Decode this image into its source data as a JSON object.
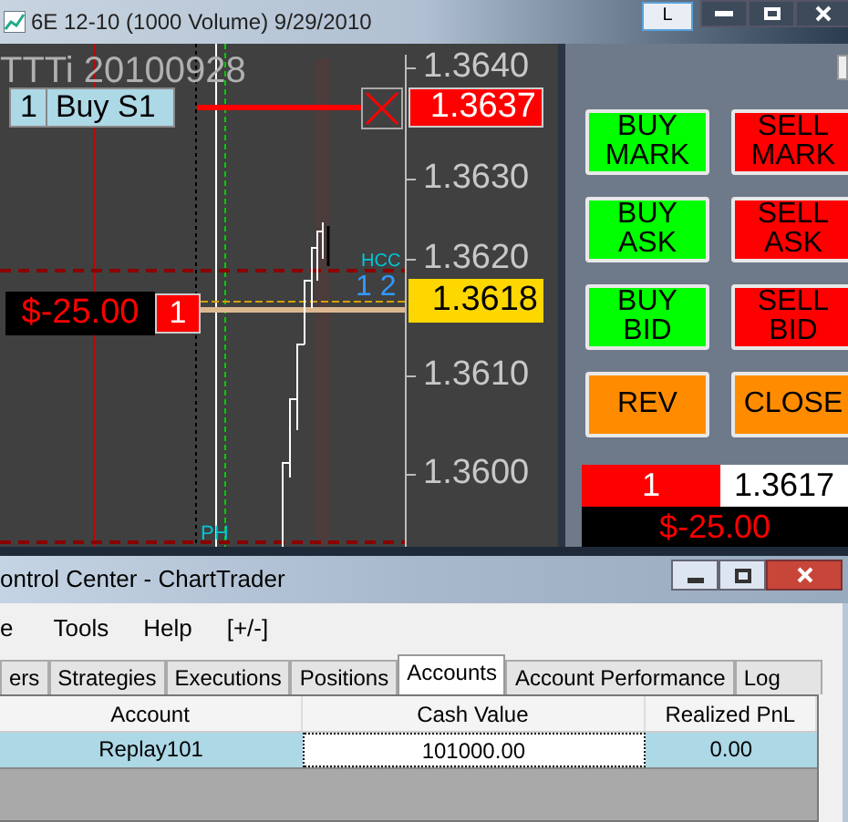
{
  "chart_window": {
    "title": "6E 12-10 (1000 Volume)  9/29/2010",
    "link_button": "L"
  },
  "chart": {
    "watermark": "TTTi  20100928",
    "price_axis": [
      "1.3640",
      "1.3630",
      "1.3620",
      "1.3610",
      "1.3600"
    ],
    "order": {
      "quantity": "1",
      "label": "Buy S1",
      "price": "1.3637"
    },
    "position": {
      "pnl": "$-25.00",
      "quantity": "1",
      "price": "1.3618"
    },
    "markers": [
      {
        "text": "HCC",
        "color": "#00c8d8"
      },
      {
        "text": "1 2",
        "color": "#3399ff"
      },
      {
        "text": "PH",
        "color": "#00c8d8"
      }
    ]
  },
  "chart_trader": {
    "buttons": [
      {
        "label": "BUY MARK",
        "kind": "buy"
      },
      {
        "label": "SELL MARK",
        "kind": "sell"
      },
      {
        "label": "BUY ASK",
        "kind": "buy"
      },
      {
        "label": "SELL ASK",
        "kind": "sell"
      },
      {
        "label": "BUY BID",
        "kind": "buy"
      },
      {
        "label": "SELL BID",
        "kind": "sell"
      },
      {
        "label": "REV",
        "kind": "neutral"
      },
      {
        "label": "CLOSE",
        "kind": "neutral"
      }
    ],
    "position_quantity": "1",
    "last_price": "1.3617",
    "pnl": "$-25.00"
  },
  "control_center": {
    "title": "ontrol Center - ChartTrader",
    "menu": [
      "e",
      "Tools",
      "Help",
      "[+/-]"
    ],
    "tabs": [
      {
        "label": "ers",
        "selected": false
      },
      {
        "label": "Strategies",
        "selected": false
      },
      {
        "label": "Executions",
        "selected": false
      },
      {
        "label": "Positions",
        "selected": false
      },
      {
        "label": "Accounts",
        "selected": true
      },
      {
        "label": "Account Performance",
        "selected": false
      },
      {
        "label": "Log",
        "selected": false
      }
    ],
    "table": {
      "columns": [
        "Account",
        "Cash Value",
        "Realized PnL"
      ],
      "rows": [
        {
          "cells": [
            "Replay101",
            "101000.00",
            "0.00"
          ],
          "selected": true
        }
      ]
    }
  }
}
